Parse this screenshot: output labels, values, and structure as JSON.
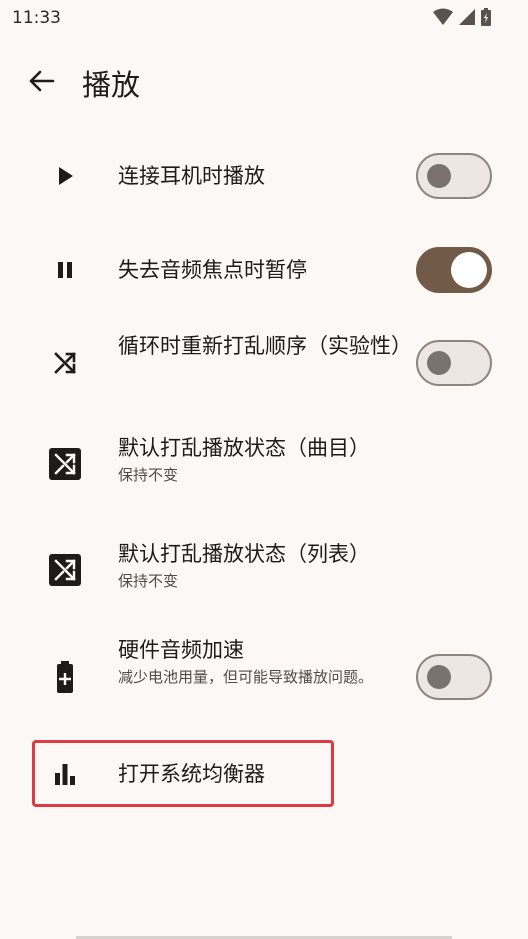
{
  "status_bar": {
    "time": "11:33",
    "icons": [
      "wifi-icon",
      "signal-icon",
      "battery-icon"
    ]
  },
  "app_bar": {
    "back_icon": "arrow-left-icon",
    "title": "播放"
  },
  "settings": [
    {
      "icon": "play-icon",
      "title": "连接耳机时播放",
      "subtitle": "",
      "control": "switch",
      "checked": false
    },
    {
      "icon": "pause-icon",
      "title": "失去音频焦点时暂停",
      "subtitle": "",
      "control": "switch",
      "checked": true
    },
    {
      "icon": "shuffle-icon",
      "title": "循环时重新打乱顺序（实验性）",
      "subtitle": "",
      "control": "switch",
      "checked": false
    },
    {
      "icon": "shuffle-box-icon",
      "title": "默认打乱播放状态（曲目）",
      "subtitle": "保持不变",
      "control": "none"
    },
    {
      "icon": "shuffle-box-icon",
      "title": "默认打乱播放状态（列表）",
      "subtitle": "保持不变",
      "control": "none"
    },
    {
      "icon": "battery-plus-icon",
      "title": "硬件音频加速",
      "subtitle": "减少电池用量，但可能导致播放问题。",
      "control": "switch",
      "checked": false
    },
    {
      "icon": "equalizer-icon",
      "title": "打开系统均衡器",
      "subtitle": "",
      "control": "none"
    }
  ],
  "colors": {
    "background": "#fcf8f5",
    "switch_on": "#725a48",
    "switch_off_track": "#ece7e3",
    "highlight": "#dc3b44"
  }
}
